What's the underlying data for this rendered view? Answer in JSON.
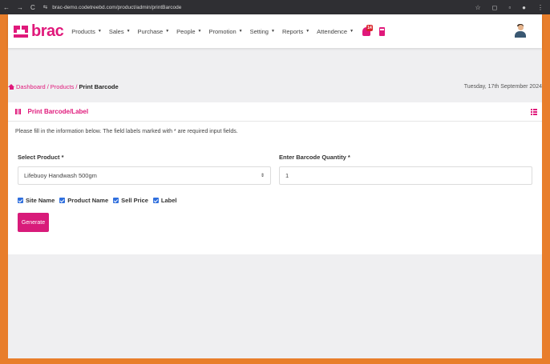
{
  "browser": {
    "url": "brac-demo.codetreebd.com/product/admin/printBarcode"
  },
  "brand": {
    "name": "brac",
    "accent": "#e0197b"
  },
  "nav": {
    "items": [
      "Products",
      "Sales",
      "Purchase",
      "People",
      "Promotion",
      "Setting",
      "Reports",
      "Attendence"
    ],
    "notification_count": "14"
  },
  "breadcrumb": {
    "dashboard": "Dashboard",
    "products": "Products",
    "current": "Print Barcode",
    "separator": "/"
  },
  "date": "Tuesday, 17th September 2024",
  "card": {
    "title": "Print Barcode/Label",
    "hint": "Please fill in the information below. The field labels marked with * are required input fields."
  },
  "form": {
    "product_label": "Select Product *",
    "product_value": "Lifebuoy Handwash 500gm",
    "qty_label": "Enter Barcode Quantity *",
    "qty_value": "1",
    "checkboxes": [
      "Site Name",
      "Product Name",
      "Sell Price",
      "Label"
    ],
    "generate_label": "Generate"
  }
}
